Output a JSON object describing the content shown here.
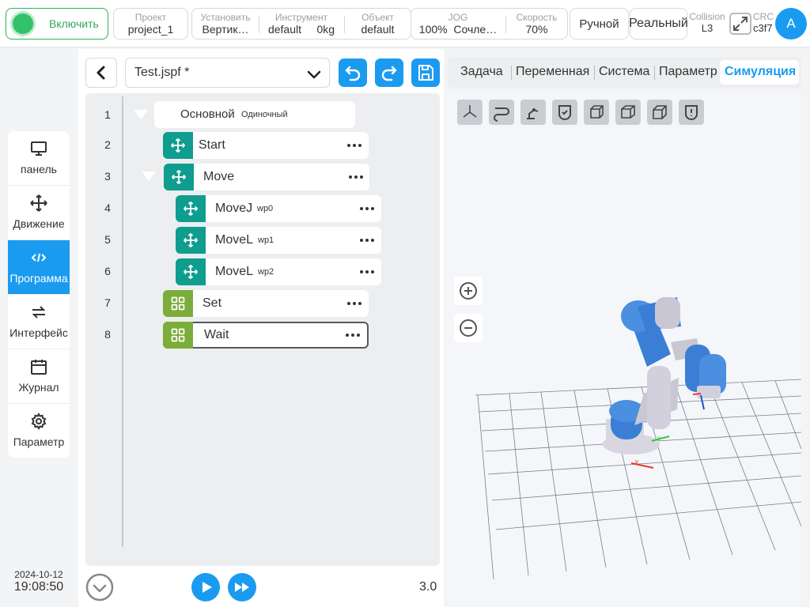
{
  "topbar": {
    "power_label": "Включить",
    "project": {
      "label": "Проект",
      "value": "project_1"
    },
    "install": {
      "label": "Установить",
      "value": "Вертик…"
    },
    "tool": {
      "label": "Инструмент",
      "value": "default",
      "weight": "0kg"
    },
    "object": {
      "label": "Объект",
      "value": "default"
    },
    "jog": {
      "label": "JOG",
      "percent": "100%",
      "mode": "Сочле…"
    },
    "speed": {
      "label": "Скорость",
      "value": "70%"
    },
    "manual_label": "Ручной",
    "real_label": "Реальный",
    "collision": {
      "label": "Collision",
      "value": "L3"
    },
    "crc": {
      "label": "CRC",
      "value": "c3f7"
    },
    "avatar_letter": "A"
  },
  "sidebar": {
    "items": [
      {
        "label": "панель",
        "icon": "monitor-icon"
      },
      {
        "label": "Движение",
        "icon": "move-icon"
      },
      {
        "label": "Программа",
        "icon": "code-icon",
        "active": true
      },
      {
        "label": "Интерфейс",
        "icon": "swap-icon"
      },
      {
        "label": "Журнал",
        "icon": "calendar-icon"
      },
      {
        "label": "Параметр",
        "icon": "gear-icon"
      }
    ],
    "date": "2024-10-12",
    "time": "19:08:50"
  },
  "program": {
    "file_name": "Test.jspf *",
    "speed_value": "3.0",
    "lines": [
      {
        "num": "1",
        "name": "Основной",
        "sub": "Одиночный",
        "kind": "main"
      },
      {
        "num": "2",
        "name": "Start",
        "sub": "",
        "kind": "move"
      },
      {
        "num": "3",
        "name": "Move",
        "sub": "",
        "kind": "move"
      },
      {
        "num": "4",
        "name": "MoveJ",
        "sub": "wp0",
        "kind": "move"
      },
      {
        "num": "5",
        "name": "MoveL",
        "sub": "wp1",
        "kind": "move"
      },
      {
        "num": "6",
        "name": "MoveL",
        "sub": "wp2",
        "kind": "move"
      },
      {
        "num": "7",
        "name": "Set",
        "sub": "",
        "kind": "set"
      },
      {
        "num": "8",
        "name": "Wait",
        "sub": "",
        "kind": "set"
      }
    ]
  },
  "right_panel": {
    "tabs": [
      "Задача",
      "Переменная",
      "Система",
      "Параметр",
      "Симуляция"
    ],
    "active_tab": "Симуляция",
    "axis_labels": {
      "x": "X",
      "y": "Y"
    }
  },
  "colors": {
    "accent": "#1a9bf0",
    "power_green": "#33c26a",
    "move_teal": "#0f9d8f",
    "set_green": "#7cad3a",
    "robot_blue": "#3a7fd5"
  }
}
